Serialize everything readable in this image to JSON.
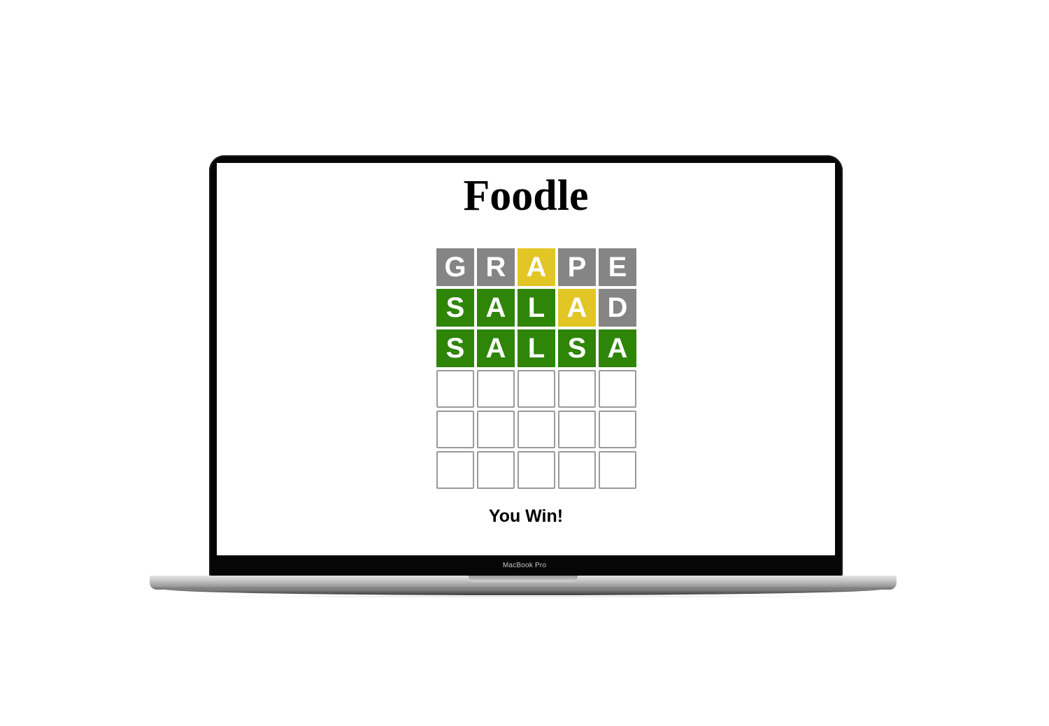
{
  "app": {
    "title": "Foodle",
    "result_message": "You Win!"
  },
  "device": {
    "model_label": "MacBook Pro"
  },
  "colors": {
    "absent": "#858585",
    "present": "#e2c625",
    "correct": "#2e8508",
    "empty_border": "#9a9a9a"
  },
  "board": {
    "rows": [
      [
        {
          "letter": "G",
          "state": "absent"
        },
        {
          "letter": "R",
          "state": "absent"
        },
        {
          "letter": "A",
          "state": "present"
        },
        {
          "letter": "P",
          "state": "absent"
        },
        {
          "letter": "E",
          "state": "absent"
        }
      ],
      [
        {
          "letter": "S",
          "state": "correct"
        },
        {
          "letter": "A",
          "state": "correct"
        },
        {
          "letter": "L",
          "state": "correct"
        },
        {
          "letter": "A",
          "state": "present"
        },
        {
          "letter": "D",
          "state": "absent"
        }
      ],
      [
        {
          "letter": "S",
          "state": "correct"
        },
        {
          "letter": "A",
          "state": "correct"
        },
        {
          "letter": "L",
          "state": "correct"
        },
        {
          "letter": "S",
          "state": "correct"
        },
        {
          "letter": "A",
          "state": "correct"
        }
      ],
      [
        {
          "letter": "",
          "state": "empty"
        },
        {
          "letter": "",
          "state": "empty"
        },
        {
          "letter": "",
          "state": "empty"
        },
        {
          "letter": "",
          "state": "empty"
        },
        {
          "letter": "",
          "state": "empty"
        }
      ],
      [
        {
          "letter": "",
          "state": "empty"
        },
        {
          "letter": "",
          "state": "empty"
        },
        {
          "letter": "",
          "state": "empty"
        },
        {
          "letter": "",
          "state": "empty"
        },
        {
          "letter": "",
          "state": "empty"
        }
      ],
      [
        {
          "letter": "",
          "state": "empty"
        },
        {
          "letter": "",
          "state": "empty"
        },
        {
          "letter": "",
          "state": "empty"
        },
        {
          "letter": "",
          "state": "empty"
        },
        {
          "letter": "",
          "state": "empty"
        }
      ]
    ]
  }
}
